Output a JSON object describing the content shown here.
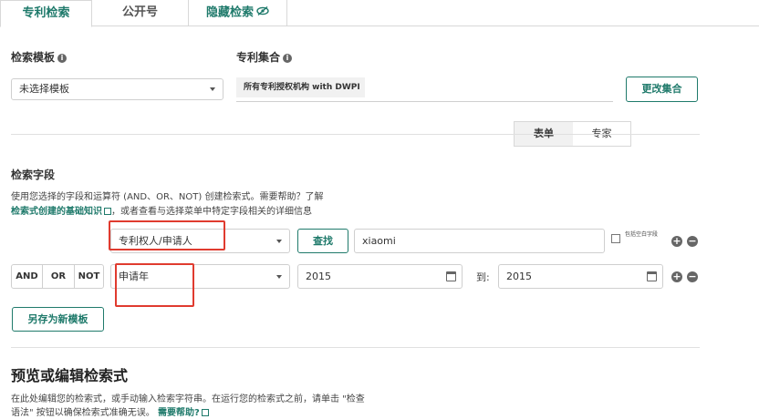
{
  "tabs": [
    {
      "label": "专利检索"
    },
    {
      "label": "公开号"
    },
    {
      "label": "隐藏检索"
    }
  ],
  "template": {
    "label": "检索模板",
    "selected": "未选择模板"
  },
  "collection": {
    "label": "专利集合",
    "value": "所有专利授权机构 with DWPI",
    "change_button": "更改集合"
  },
  "view_toggle": {
    "form": "表单",
    "expert": "专家"
  },
  "search_fields": {
    "title": "检索字段",
    "desc_line1": "使用您选择的字段和运算符 (AND、OR、NOT) 创建检索式。需要帮助？了解",
    "desc_link": "检索式创建的基础知识",
    "desc_line2": "，或者查看与选择菜单中特定字段相关的详细信息",
    "row1": {
      "field": "专利权人/申请人",
      "find_button": "查找",
      "value": "xiaomi",
      "checkbox_label": "包括空白字段"
    },
    "row2": {
      "operators": [
        "AND",
        "OR",
        "NOT"
      ],
      "field": "申请年",
      "from": "2015",
      "to_label": "到:",
      "to": "2015"
    },
    "save_template_button": "另存为新模板"
  },
  "preview": {
    "title": "预览或编辑检索式",
    "desc_line1": "在此处编辑您的检索式，或手动输入检索字符串。在运行您的检索式之前，请单击 \"检查",
    "desc_line2": "语法\" 按钮以确保检索式准确无误。",
    "help_link": "需要帮助?"
  },
  "colors": {
    "accent": "#1f7a6b",
    "highlight": "#e03b2f"
  }
}
